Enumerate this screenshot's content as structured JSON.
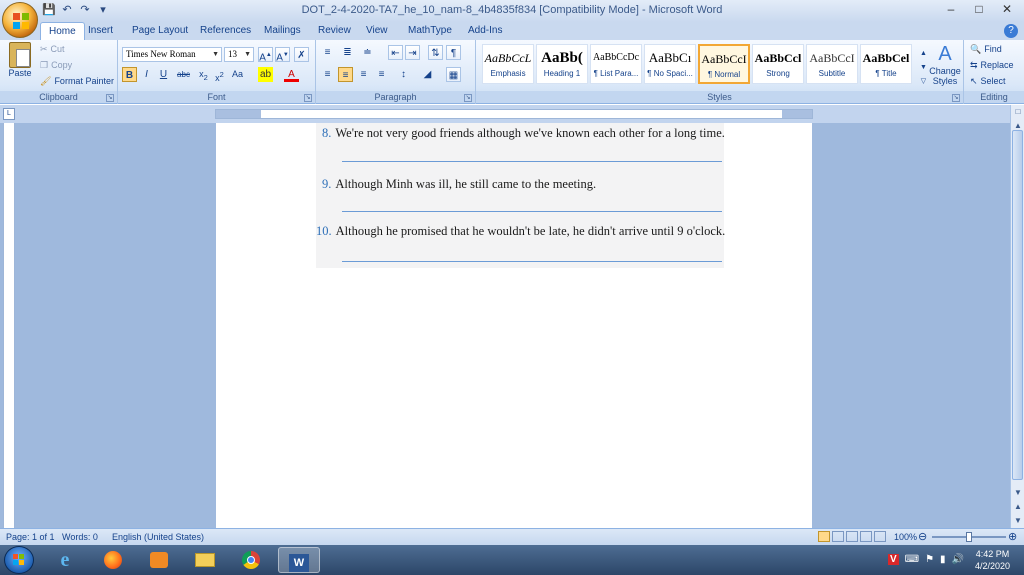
{
  "window": {
    "title": "DOT_2-4-2020-TA7_he_10_nam-8_4b4835f834 [Compatibility Mode] - Microsoft Word",
    "minimize": "–",
    "restore": "□",
    "close": "✕"
  },
  "tabs": [
    "Home",
    "Insert",
    "Page Layout",
    "References",
    "Mailings",
    "Review",
    "View",
    "MathType",
    "Add-Ins"
  ],
  "active_tab": "Home",
  "clipboard": {
    "paste": "Paste",
    "cut": "Cut",
    "copy": "Copy",
    "format_painter": "Format Painter",
    "label": "Clipboard"
  },
  "font": {
    "name": "Times New Roman",
    "size": "13",
    "label": "Font"
  },
  "paragraph": {
    "label": "Paragraph"
  },
  "styles": {
    "label": "Styles",
    "items": [
      {
        "sample": "AaBbCcL",
        "name": "Emphasis"
      },
      {
        "sample": "AaBb(",
        "name": "Heading 1"
      },
      {
        "sample": "AaBbCcDc",
        "name": "¶ List Para..."
      },
      {
        "sample": "AaBbCı",
        "name": "¶ No Spaci..."
      },
      {
        "sample": "AaBbCcI",
        "name": "¶ Normal"
      },
      {
        "sample": "AaBbCcl",
        "name": "Strong"
      },
      {
        "sample": "AaBbCcI",
        "name": "Subtitle"
      },
      {
        "sample": "AaBbCel",
        "name": "¶ Title"
      }
    ],
    "change_styles": "Change Styles"
  },
  "editing": {
    "find": "Find",
    "replace": "Replace",
    "select": "Select",
    "label": "Editing"
  },
  "document": {
    "questions": [
      {
        "num": "8.",
        "text": "We're not very good friends although we've known each other for a long time."
      },
      {
        "num": "9.",
        "text": "Although Minh was ill, he still came to the meeting."
      },
      {
        "num": "10.",
        "text": "Although he promised that he wouldn't be late, he didn't arrive until 9 o'clock."
      }
    ]
  },
  "status": {
    "page": "Page: 1 of 1",
    "words": "Words: 0",
    "language": "English (United States)",
    "zoom": "100%"
  },
  "clock": {
    "time": "4:42 PM",
    "date": "4/2/2020"
  }
}
